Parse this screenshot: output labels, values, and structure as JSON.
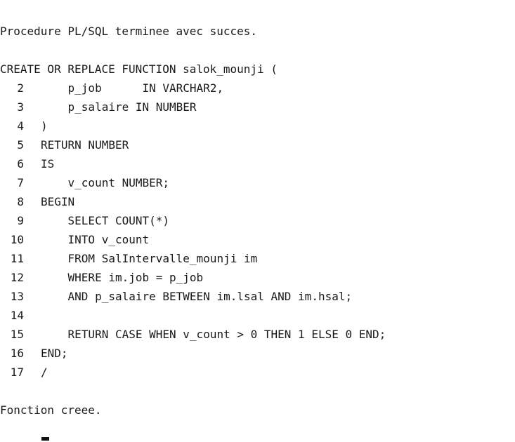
{
  "messages": {
    "procedure_done": "Procedure PL/SQL terminee avec succes.",
    "function_created": "Fonction creee."
  },
  "code": {
    "first_line": "CREATE OR REPLACE FUNCTION salok_mounji (",
    "lines": [
      {
        "num": "2",
        "text": "    p_job      IN VARCHAR2,"
      },
      {
        "num": "3",
        "text": "    p_salaire IN NUMBER"
      },
      {
        "num": "4",
        "text": ")"
      },
      {
        "num": "5",
        "text": "RETURN NUMBER"
      },
      {
        "num": "6",
        "text": "IS"
      },
      {
        "num": "7",
        "text": "    v_count NUMBER;"
      },
      {
        "num": "8",
        "text": "BEGIN"
      },
      {
        "num": "9",
        "text": "    SELECT COUNT(*)"
      },
      {
        "num": "10",
        "text": "    INTO v_count"
      },
      {
        "num": "11",
        "text": "    FROM SalIntervalle_mounji im"
      },
      {
        "num": "12",
        "text": "    WHERE im.job = p_job"
      },
      {
        "num": "13",
        "text": "    AND p_salaire BETWEEN im.lsal AND im.hsal;"
      },
      {
        "num": "14",
        "text": ""
      },
      {
        "num": "15",
        "text": "    RETURN CASE WHEN v_count > 0 THEN 1 ELSE 0 END;"
      },
      {
        "num": "16",
        "text": "END;"
      },
      {
        "num": "17",
        "text": "/"
      }
    ]
  }
}
